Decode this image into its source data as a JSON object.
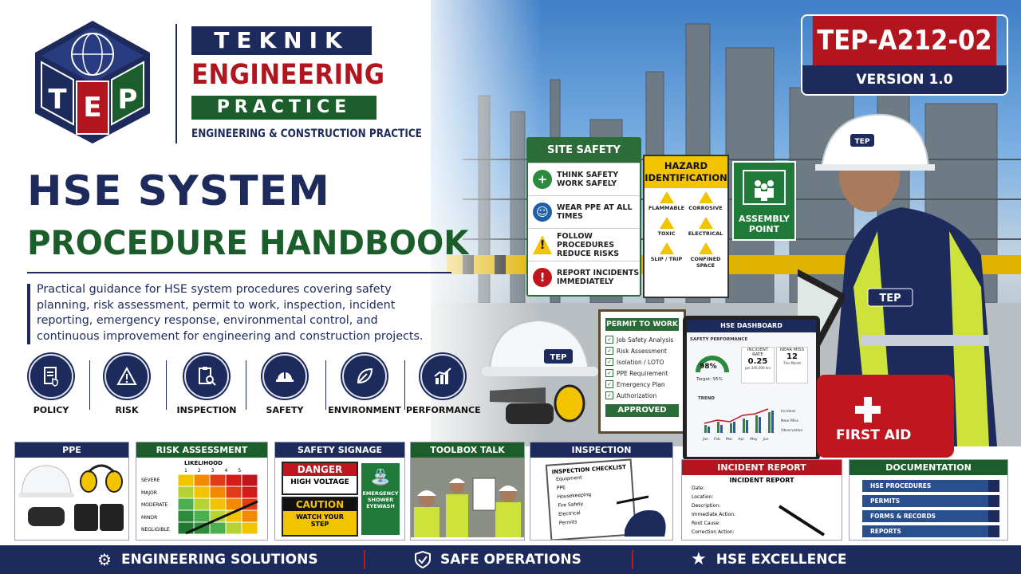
{
  "brand": {
    "logo_letters": [
      "T",
      "E",
      "P"
    ],
    "line1": "TEKNIK",
    "line2": "ENGINEERING",
    "line3": "PRACTICE",
    "tagline": "ENGINEERING & CONSTRUCTION PRACTICE"
  },
  "document": {
    "code": "TEP-A212-02",
    "version": "VERSION 1.0"
  },
  "title": {
    "line1": "HSE SYSTEM",
    "line2": "PROCEDURE HANDBOOK",
    "description": "Practical guidance for HSE system procedures covering safety planning, risk assessment, permit to work, inspection, incident reporting, emergency response, environmental control, and continuous improvement for engineering and construction projects."
  },
  "categories": [
    {
      "label": "POLICY",
      "icon": "policy-document-icon"
    },
    {
      "label": "RISK",
      "icon": "warning-triangle-icon"
    },
    {
      "label": "INSPECTION",
      "icon": "clipboard-search-icon"
    },
    {
      "label": "SAFETY",
      "icon": "hard-hat-icon"
    },
    {
      "label": "ENVIRONMENT",
      "icon": "leaf-icon"
    },
    {
      "label": "PERFORMANCE",
      "icon": "bar-chart-icon"
    }
  ],
  "site_safety_sign": {
    "heading": "SITE SAFETY",
    "rows": [
      {
        "text": "THINK SAFETY WORK SAFELY",
        "icon": "plus-icon",
        "color": "#2b8a3e"
      },
      {
        "text": "WEAR PPE AT ALL TIMES",
        "icon": "head-protection-icon",
        "color": "#1f5fa8"
      },
      {
        "text": "FOLLOW PROCEDURES REDUCE RISKS",
        "icon": "warning-icon",
        "color": "#f2c400"
      },
      {
        "text": "REPORT INCIDENTS IMMEDIATELY",
        "icon": "exclamation-icon",
        "color": "#c0161f"
      }
    ]
  },
  "hazard_sign": {
    "heading": "HAZARD IDENTIFICATION",
    "items": [
      "FLAMMABLE",
      "CORROSIVE",
      "TOXIC",
      "ELECTRICAL",
      "SLIP / TRIP",
      "CONFINED SPACE"
    ]
  },
  "assembly_sign": {
    "label": "ASSEMBLY POINT"
  },
  "worker_badge": "TEP",
  "helmet_badge": "TEP",
  "permit_board": {
    "heading": "PERMIT TO WORK",
    "items": [
      "Job Safety Analysis",
      "Risk Assessment",
      "Isolation / LOTO",
      "PPE Requirement",
      "Emergency Plan",
      "Authorization"
    ],
    "stamp": "APPROVED"
  },
  "dashboard": {
    "heading": "HSE DASHBOARD",
    "performance_label": "SAFETY PERFORMANCE",
    "performance_value": "98%",
    "target": "Target: 95%",
    "incident_rate_label": "INCIDENT RATE",
    "incident_rate_value": "0.25",
    "incident_rate_unit": "per 200,000 hrs",
    "near_miss_label": "NEAR MISS",
    "near_miss_value": "12",
    "near_miss_unit": "This Month",
    "trend_label": "TREND",
    "months": [
      "Jan",
      "Feb",
      "Mar",
      "Apr",
      "May",
      "Jun"
    ],
    "legend": [
      "Incident",
      "Near Miss",
      "Observation"
    ]
  },
  "first_aid": "FIRST AID",
  "cards": {
    "ppe": {
      "heading": "PPE"
    },
    "risk": {
      "heading": "RISK ASSESSMENT",
      "likelihood": "LIKELIHOOD",
      "columns": [
        "1",
        "2",
        "3",
        "4",
        "5"
      ],
      "rows": [
        "SEVERE",
        "MAJOR",
        "MODERATE",
        "MINOR",
        "NEGLIGIBLE"
      ]
    },
    "signage": {
      "heading": "SAFETY SIGNAGE",
      "danger": "DANGER",
      "danger_text": "HIGH VOLTAGE",
      "caution": "CAUTION",
      "caution_text": "WATCH YOUR STEP",
      "eyewash": "EMERGENCY SHOWER EYEWASH"
    },
    "toolbox": {
      "heading": "TOOLBOX TALK"
    },
    "inspection": {
      "heading": "INSPECTION",
      "checklist_title": "INSPECTION CHECKLIST",
      "items": [
        "Equipment",
        "PPE",
        "Housekeeping",
        "Fire Safety",
        "Electrical",
        "Permits"
      ]
    },
    "incident": {
      "heading": "INCIDENT REPORT",
      "form_title": "INCIDENT REPORT",
      "fields": [
        "Date:",
        "Location:",
        "Description:",
        "Immediate Action:",
        "Root Cause:",
        "Correction Action:"
      ]
    },
    "documentation": {
      "heading": "DOCUMENTATION",
      "binders": [
        "HSE PROCEDURES",
        "PERMITS",
        "FORMS & RECORDS",
        "REPORTS"
      ]
    }
  },
  "footer": [
    {
      "label": "ENGINEERING SOLUTIONS",
      "icon": "gear-icon"
    },
    {
      "label": "SAFE OPERATIONS",
      "icon": "shield-check-icon"
    },
    {
      "label": "HSE EXCELLENCE",
      "icon": "star-icon"
    }
  ],
  "colors": {
    "navy": "#1d2a5c",
    "red": "#b3151e",
    "green": "#1b5d2b",
    "yellow": "#f2c400"
  }
}
